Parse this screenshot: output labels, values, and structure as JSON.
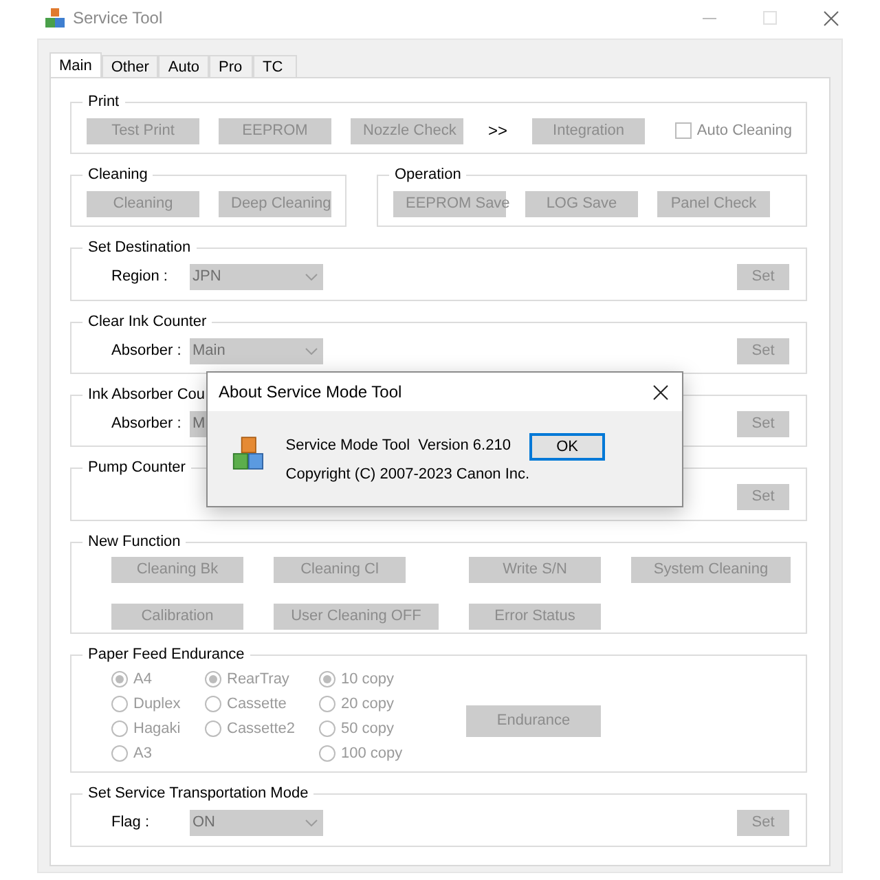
{
  "window": {
    "title": "Service Tool"
  },
  "tabs": [
    {
      "label": "Main",
      "selected": true
    },
    {
      "label": "Other",
      "selected": false
    },
    {
      "label": "Auto",
      "selected": false
    },
    {
      "label": "Pro",
      "selected": false
    },
    {
      "label": "TC",
      "selected": false
    }
  ],
  "group_rows": [
    {
      "groups": [
        {
          "kind": "buttons",
          "title": "Print",
          "items": [
            {
              "kind": "button",
              "label": "Test Print",
              "disabled": true
            },
            {
              "kind": "button",
              "label": "EEPROM",
              "disabled": true
            },
            {
              "kind": "button",
              "label": "Nozzle Check",
              "disabled": true
            },
            {
              "kind": "text",
              "label": ">>"
            },
            {
              "kind": "button",
              "label": "Integration",
              "disabled": true
            },
            {
              "kind": "checkbox",
              "label": "Auto Cleaning",
              "checked": false
            }
          ]
        }
      ]
    },
    {
      "groups": [
        {
          "kind": "buttons",
          "title": "Cleaning",
          "items": [
            {
              "kind": "button",
              "label": "Cleaning",
              "disabled": true
            },
            {
              "kind": "button",
              "label": "Deep Cleaning",
              "disabled": true
            }
          ]
        },
        {
          "kind": "buttons",
          "title": "Operation",
          "items": [
            {
              "kind": "button",
              "label": "EEPROM Save",
              "disabled": true
            },
            {
              "kind": "button",
              "label": "LOG Save",
              "disabled": true
            },
            {
              "kind": "button",
              "label": "Panel Check",
              "disabled": true
            }
          ]
        }
      ]
    },
    {
      "groups": [
        {
          "kind": "select",
          "title": "Set Destination",
          "label": "Region :",
          "value": "JPN",
          "button": {
            "label": "Set",
            "disabled": true
          }
        }
      ]
    },
    {
      "groups": [
        {
          "kind": "select",
          "title": "Clear Ink Counter",
          "label": "Absorber :",
          "value": "Main",
          "button": {
            "label": "Set",
            "disabled": true
          }
        }
      ]
    },
    {
      "groups": [
        {
          "kind": "select",
          "title": "Ink Absorber Cou",
          "label": "Absorber :",
          "value": "M",
          "button": {
            "label": "Set",
            "disabled": true
          }
        }
      ]
    },
    {
      "groups": [
        {
          "kind": "select",
          "title": "Pump Counter",
          "button": {
            "label": "Set",
            "disabled": true
          }
        }
      ]
    },
    {
      "groups": [
        {
          "kind": "grid",
          "title": "New Function",
          "items": [
            {
              "label": "Cleaning Bk",
              "disabled": true
            },
            {
              "label": "Cleaning Cl",
              "disabled": true
            },
            {
              "label": "Write S/N",
              "disabled": true
            },
            {
              "label": "System Cleaning",
              "disabled": true
            },
            {
              "label": "Calibration",
              "disabled": true
            },
            {
              "label": "User Cleaning OFF",
              "disabled": true
            },
            {
              "label": "Error Status",
              "disabled": true
            }
          ]
        }
      ]
    },
    {
      "groups": [
        {
          "kind": "radios",
          "title": "Paper Feed Endurance",
          "columns": [
            [
              {
                "label": "A4",
                "selected": true
              },
              {
                "label": "Duplex",
                "selected": false
              },
              {
                "label": "Hagaki",
                "selected": false
              },
              {
                "label": "A3",
                "selected": false
              }
            ],
            [
              {
                "label": "RearTray",
                "selected": true
              },
              {
                "label": "Cassette",
                "selected": false
              },
              {
                "label": "Cassette2",
                "selected": false
              }
            ],
            [
              {
                "label": "10 copy",
                "selected": true
              },
              {
                "label": "20 copy",
                "selected": false
              },
              {
                "label": "50 copy",
                "selected": false
              },
              {
                "label": "100 copy",
                "selected": false
              }
            ]
          ],
          "button": {
            "label": "Endurance",
            "disabled": true
          }
        }
      ]
    },
    {
      "groups": [
        {
          "kind": "select",
          "title": "Set Service Transportation Mode",
          "label": "Flag :",
          "value": "ON",
          "button": {
            "label": "Set",
            "disabled": true
          }
        }
      ]
    }
  ],
  "dialog": {
    "title": "About Service Mode Tool",
    "lines": [
      "Service Mode Tool  Version 6.210",
      "Copyright (C) 2007-2023 Canon Inc."
    ],
    "button": "OK"
  }
}
